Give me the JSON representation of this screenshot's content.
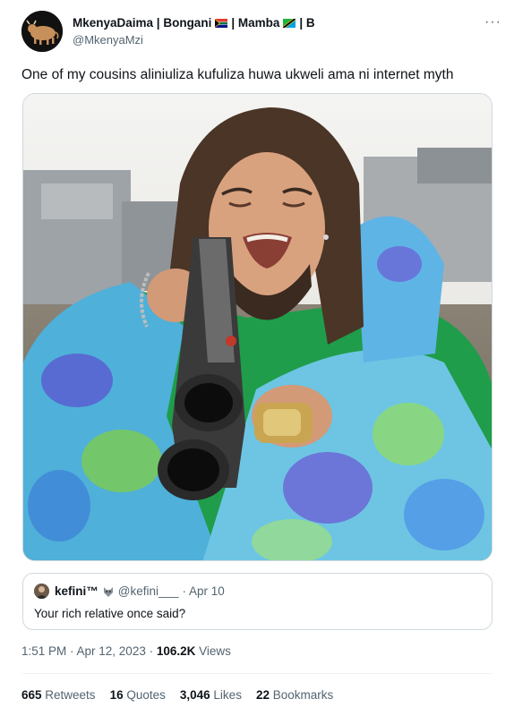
{
  "author": {
    "display_name_part1": "MkenyaDaima | Bongani",
    "display_name_part2": " | Mamba ",
    "display_name_part3": " | B",
    "handle": "@MkenyaMzi",
    "avatar_icon": "bull-avatar-icon"
  },
  "more_label": "···",
  "tweet": {
    "text": "One of my cousins aliniuliza kufuliza huwa ukweli ama ni internet myth"
  },
  "quote": {
    "name": "kefini™",
    "handle": "@kefini___",
    "date": "· Apr 10",
    "text": "Your rich relative once said?"
  },
  "meta": {
    "time": "1:51 PM · Apr 12, 2023 · ",
    "views_count": "106.2K",
    "views_label": " Views"
  },
  "stats": {
    "retweets_count": "665",
    "retweets_label": " Retweets",
    "quotes_count": "16",
    "quotes_label": " Quotes",
    "likes_count": "3,046",
    "likes_label": " Likes",
    "bookmarks_count": "22",
    "bookmarks_label": " Bookmarks"
  },
  "colors": {
    "text_primary": "#0f1419",
    "text_secondary": "#536471",
    "border": "#cfd9de",
    "jacket_green": "#1f9d4a",
    "tiedye_blue": "#5aa9e6",
    "tiedye_purple": "#6c5bd4"
  }
}
